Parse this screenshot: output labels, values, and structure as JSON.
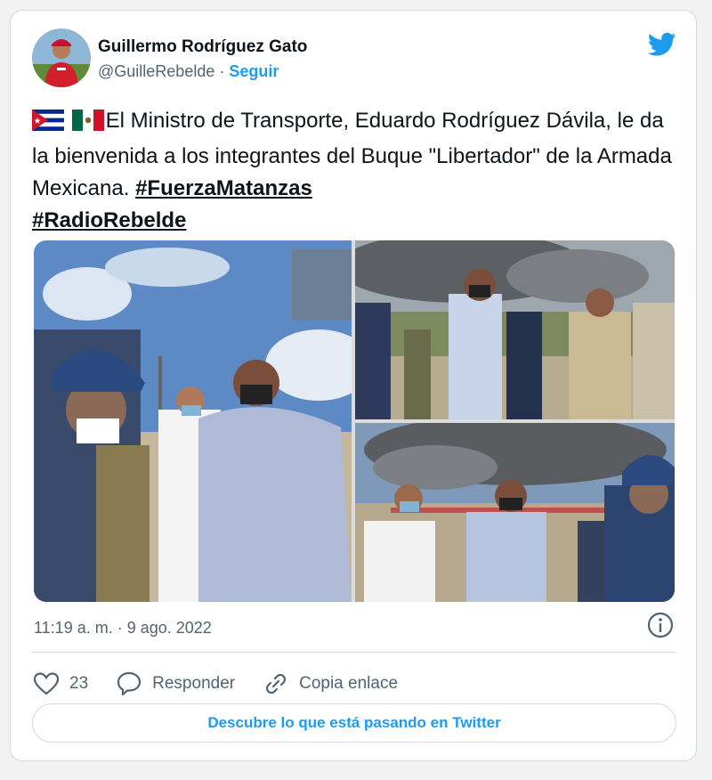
{
  "author": {
    "name": "Guillermo Rodríguez Gato",
    "handle": "@GuilleRebelde",
    "separator": " · ",
    "follow_label": "Seguir"
  },
  "tweet": {
    "text": "El Ministro de Transporte, Eduardo Rodríguez Dávila, le da la bienvenida a los integrantes del Buque \"Libertador\" de la Armada Mexicana. ",
    "hashtags": [
      "#FuerzaMatanzas",
      "#RadioRebelde"
    ],
    "flags": [
      "cuba-flag-icon",
      "mexico-flag-icon"
    ]
  },
  "timestamp": "11:19 a. m. · 9 ago. 2022",
  "actions": {
    "likes_count": "23",
    "reply_label": "Responder",
    "copy_link_label": "Copia enlace"
  },
  "cta_label": "Descubre lo que está pasando en Twitter",
  "icons": {
    "brand": "twitter-bird-icon",
    "info": "info-icon",
    "like": "heart-icon",
    "reply": "speech-bubble-icon",
    "link": "link-icon"
  },
  "colors": {
    "brand": "#1d9bf0",
    "text": "#0f1419",
    "muted": "#536471",
    "border": "#cfd9de"
  }
}
